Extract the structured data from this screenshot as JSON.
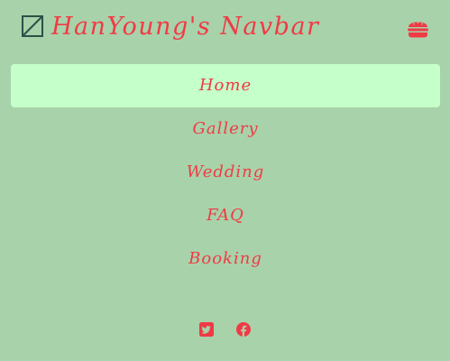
{
  "colors": {
    "background": "#a8d2aa",
    "accent": "#f03a45",
    "active_item_bg": "#c5ffc9",
    "logo": "#2d5048"
  },
  "navbar": {
    "logo_icon": "square-slash-icon",
    "title": "HanYoung's Navbar",
    "menu_icon": "hamburger-icon"
  },
  "menu": {
    "items": [
      {
        "label": "Home",
        "active": true
      },
      {
        "label": "Gallery",
        "active": false
      },
      {
        "label": "Wedding",
        "active": false
      },
      {
        "label": "FAQ",
        "active": false
      },
      {
        "label": "Booking",
        "active": false
      }
    ]
  },
  "social": {
    "icons": [
      "twitter-icon",
      "facebook-icon"
    ]
  }
}
